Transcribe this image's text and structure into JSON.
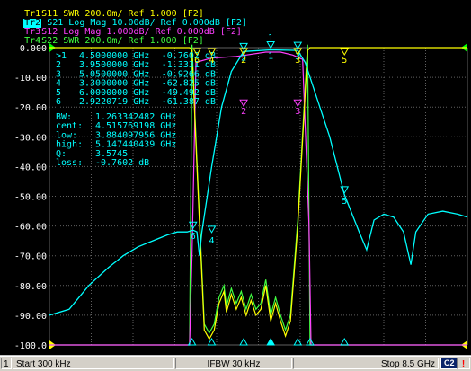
{
  "traces": [
    {
      "id": "Tr1",
      "param": "S11",
      "desc": "SWR 200.0m/ Ref 1.000 [F2]",
      "color": "#ffff00",
      "active": false
    },
    {
      "id": "Tr2",
      "param": "S21",
      "desc": "Log Mag 10.00dB/ Ref 0.000dB [F2]",
      "color": "#00ffff",
      "active": true
    },
    {
      "id": "Tr3",
      "param": "S12",
      "desc": "Log Mag 1.000dB/ Ref 0.000dB [F2]",
      "color": "#ff40ff",
      "active": false
    },
    {
      "id": "Tr4",
      "param": "S22",
      "desc": "SWR 200.0m/ Ref 1.000 [F2]",
      "color": "#40ff40",
      "active": false
    }
  ],
  "y_labels": [
    "0.000",
    "-10.00",
    "-20.00",
    "-30.00",
    "-40.00",
    "-50.00",
    "-60.00",
    "-70.00",
    "-80.00",
    "-90.00",
    "-100.0"
  ],
  "markers": [
    {
      "sel": ">1",
      "freq": "4.5000000 GHz",
      "val": "-0.7602 dB"
    },
    {
      "sel": " 2",
      "freq": "3.9500000 GHz",
      "val": "-1.3331 dB"
    },
    {
      "sel": " 3",
      "freq": "5.0500000 GHz",
      "val": "-0.9266 dB"
    },
    {
      "sel": " 4",
      "freq": "3.3000000 GHz",
      "val": "-62.825 dB"
    },
    {
      "sel": " 5",
      "freq": "6.0000000 GHz",
      "val": "-49.492 dB"
    },
    {
      "sel": " 6",
      "freq": "2.9220719 GHz",
      "val": "-61.387 dB"
    }
  ],
  "bw_stats": [
    {
      "label": "   BW:",
      "value": "1.263342482 GHz"
    },
    {
      "label": " cent:",
      "value": "4.515769198 GHz"
    },
    {
      "label": "  low:",
      "value": "3.884097956 GHz"
    },
    {
      "label": " high:",
      "value": "5.147440439 GHz"
    },
    {
      "label": "    Q:",
      "value": "3.5745"
    },
    {
      "label": " loss:",
      "value": "-0.7602 dB"
    }
  ],
  "marker_tags": [
    "1",
    "2",
    "3",
    "4",
    "5",
    "6"
  ],
  "statusbar": {
    "channel": "1",
    "start": "Start 300 kHz",
    "ifbw": "IFBW 30 kHz",
    "stop": "Stop 8.5 GHz",
    "c2": "C2",
    "trailing": "!"
  },
  "colors": {
    "s11": "#ffff00",
    "s21": "#00ffff",
    "s12": "#ff40ff",
    "s22": "#40ff40",
    "grid": "#606060",
    "ref_arrow": "#00ff00",
    "axis_text": "#ffffff"
  }
}
